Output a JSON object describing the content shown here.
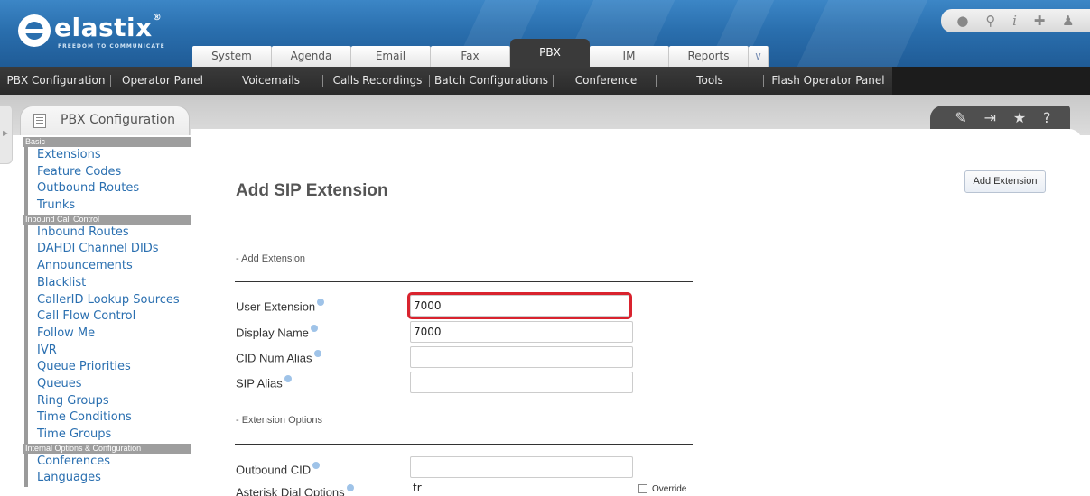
{
  "brand": {
    "name": "elastix",
    "tagline": "FREEDOM TO COMMUNICATE"
  },
  "top_tabs": [
    {
      "label": "System"
    },
    {
      "label": "Agenda"
    },
    {
      "label": "Email"
    },
    {
      "label": "Fax"
    },
    {
      "label": "PBX"
    },
    {
      "label": "IM"
    },
    {
      "label": "Reports"
    }
  ],
  "header_icons": [
    "drop-icon",
    "search-icon",
    "info-icon",
    "puzzle-icon",
    "user-icon"
  ],
  "subnav": [
    {
      "label": "PBX Configuration"
    },
    {
      "label": "Operator Panel"
    },
    {
      "label": "Voicemails"
    },
    {
      "label": "Calls Recordings"
    },
    {
      "label": "Batch Configurations"
    },
    {
      "label": "Conference"
    },
    {
      "label": "Tools"
    },
    {
      "label": "Flash Operator Panel"
    }
  ],
  "module": {
    "title": "PBX Configuration",
    "tools": [
      "edit-icon",
      "export-icon",
      "star-icon",
      "help-icon"
    ]
  },
  "sidebar": {
    "groups": [
      {
        "header": "Basic",
        "items": [
          "Extensions",
          "Feature Codes",
          "Outbound Routes",
          "Trunks"
        ]
      },
      {
        "header": "Inbound Call Control",
        "items": [
          "Inbound Routes",
          "DAHDI Channel DIDs",
          "Announcements",
          "Blacklist",
          "CallerID Lookup Sources",
          "Call Flow Control",
          "Follow Me",
          "IVR",
          "Queue Priorities",
          "Queues",
          "Ring Groups",
          "Time Conditions",
          "Time Groups"
        ]
      },
      {
        "header": "Internal Options & Configuration",
        "items": [
          "Conferences",
          "Languages"
        ]
      }
    ]
  },
  "form": {
    "title": "Add SIP Extension",
    "add_button": "Add Extension",
    "section_add": "- Add Extension",
    "section_options": "- Extension Options",
    "fields": {
      "user_extension": {
        "label": "User Extension",
        "value": "7000"
      },
      "display_name": {
        "label": "Display Name",
        "value": "7000"
      },
      "cid_num_alias": {
        "label": "CID Num Alias",
        "value": ""
      },
      "sip_alias": {
        "label": "SIP Alias",
        "value": ""
      },
      "outbound_cid": {
        "label": "Outbound CID",
        "value": ""
      },
      "asterisk_dial_options": {
        "label": "Asterisk Dial Options",
        "value": "tr"
      }
    },
    "override_label": "Override"
  },
  "colors": {
    "header_blue": "#2a6fae",
    "link_blue": "#2a6fb0",
    "highlight_red": "#d9232e",
    "nav_dark": "#2a2a2a"
  }
}
